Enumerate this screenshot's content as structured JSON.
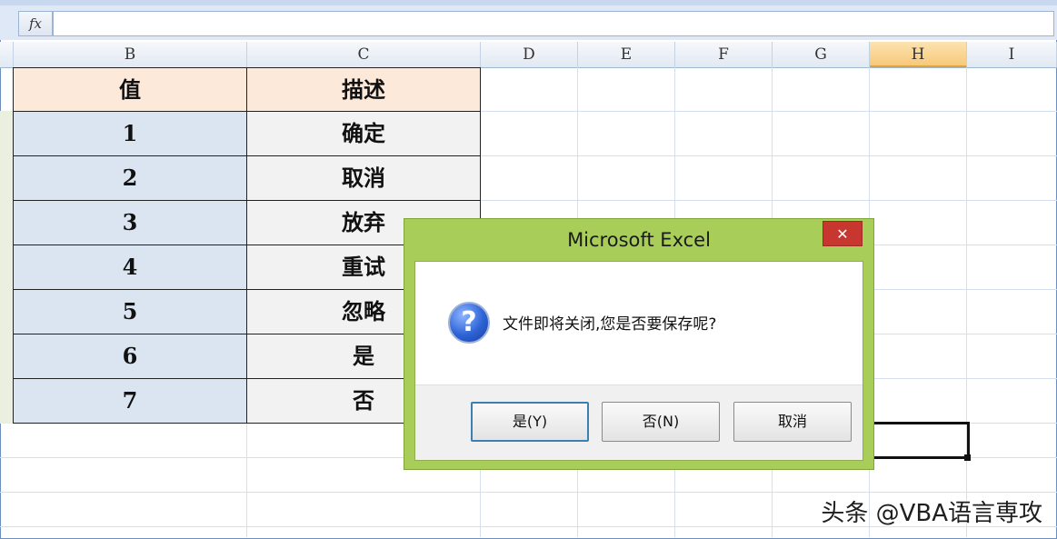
{
  "formula_bar": {
    "fx_label": "fx",
    "value": ""
  },
  "columns": [
    "B",
    "C",
    "D",
    "E",
    "F",
    "G",
    "H",
    "I"
  ],
  "selected_column": "H",
  "table": {
    "header": {
      "value": "值",
      "description": "描述"
    },
    "rows": [
      {
        "value": "1",
        "description": "确定"
      },
      {
        "value": "2",
        "description": "取消"
      },
      {
        "value": "3",
        "description": "放弃"
      },
      {
        "value": "4",
        "description": "重试"
      },
      {
        "value": "5",
        "description": "忽略"
      },
      {
        "value": "6",
        "description": "是"
      },
      {
        "value": "7",
        "description": "否"
      }
    ]
  },
  "dialog": {
    "title": "Microsoft Excel",
    "close_label": "✕",
    "icon": "question-icon",
    "icon_glyph": "?",
    "message": "文件即将关闭,您是否要保存呢?",
    "buttons": [
      {
        "label": "是(Y)",
        "default": true
      },
      {
        "label": "否(N)",
        "default": false
      },
      {
        "label": "取消",
        "default": false
      }
    ],
    "colors": {
      "frame": "#a8ce59",
      "close": "#c7372f"
    }
  },
  "watermark": "头条 @VBA语言専攻"
}
